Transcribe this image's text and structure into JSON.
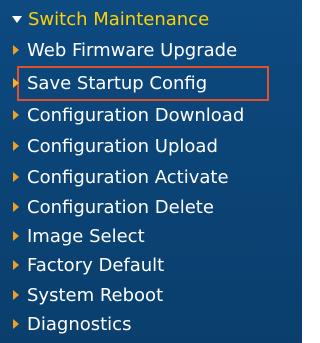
{
  "menu": {
    "section_title": "Switch Maintenance",
    "items": [
      {
        "label": "Web Firmware Upgrade"
      },
      {
        "label": "Save Startup Config"
      },
      {
        "label": "Configuration Download"
      },
      {
        "label": "Configuration Upload"
      },
      {
        "label": "Configuration Activate"
      },
      {
        "label": "Configuration Delete"
      },
      {
        "label": "Image Select"
      },
      {
        "label": "Factory Default"
      },
      {
        "label": "System Reboot"
      },
      {
        "label": "Diagnostics"
      }
    ]
  },
  "colors": {
    "background": "#0b4477",
    "section_title": "#ffd200",
    "item_text": "#ffffff",
    "arrow": "#f0a020",
    "highlight_border": "#e0502a"
  }
}
